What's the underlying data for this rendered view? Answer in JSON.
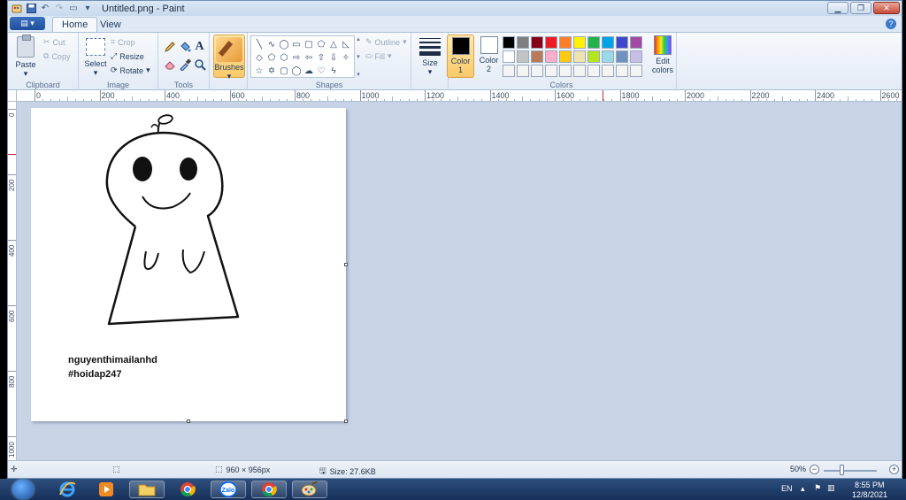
{
  "window": {
    "title": "Untitled.png - Paint"
  },
  "tabs": [
    {
      "label": "Home"
    },
    {
      "label": "View"
    }
  ],
  "ribbon": {
    "clipboard": {
      "paste": "Paste",
      "cut": "Cut",
      "copy": "Copy",
      "group_label": "Clipboard"
    },
    "image": {
      "select": "Select",
      "crop": "Crop",
      "resize": "Resize",
      "rotate": "Rotate",
      "group_label": "Image"
    },
    "tools": {
      "group_label": "Tools"
    },
    "brushes": {
      "label": "Brushes"
    },
    "shapes": {
      "outline": "Outline",
      "fill": "Fill",
      "group_label": "Shapes",
      "icons": [
        "line-icon",
        "curve-icon",
        "oval-icon",
        "rectangle-icon",
        "rounded-rectangle-icon",
        "polygon-icon",
        "triangle-icon",
        "right-triangle-icon",
        "diamond-icon",
        "pentagon-icon",
        "hexagon-icon",
        "right-arrow-icon",
        "left-arrow-icon",
        "up-arrow-icon",
        "down-arrow-icon",
        "four-point-star-icon",
        "five-point-star-icon",
        "six-point-star-icon",
        "rounded-callout-icon",
        "oval-callout-icon",
        "cloud-callout-icon",
        "heart-icon",
        "lightning-icon"
      ]
    },
    "size": {
      "label": "Size"
    },
    "colors": {
      "color1_label": "Color",
      "color1_num": "1",
      "color2_label": "Color",
      "color2_num": "2",
      "color1": "#000000",
      "color2": "#ffffff",
      "edit_label": "Edit",
      "edit_label2": "colors",
      "group_label": "Colors",
      "palette": [
        "#000000",
        "#7f7f7f",
        "#880015",
        "#ed1c24",
        "#ff7f27",
        "#fff200",
        "#22b14c",
        "#00a2e8",
        "#3f48cc",
        "#a349a4",
        "#ffffff",
        "#c3c3c3",
        "#b97a57",
        "#ffaec9",
        "#ffc90e",
        "#efe4b0",
        "#b5e61d",
        "#99d9ea",
        "#7092be",
        "#c8bfe7",
        "#f4f4f4",
        "#f4f4f4",
        "#f4f4f4",
        "#f4f4f4",
        "#f4f4f4",
        "#f4f4f4",
        "#f4f4f4",
        "#f4f4f4",
        "#f4f4f4",
        "#f4f4f4"
      ]
    }
  },
  "ruler": {
    "h_labels": [
      "0",
      "200",
      "400",
      "600",
      "800",
      "1000",
      "1200",
      "1400",
      "1600",
      "1800",
      "2000",
      "2200",
      "2400",
      "2600"
    ],
    "v_labels": [
      "0",
      "200",
      "400",
      "600",
      "800",
      "1000"
    ]
  },
  "canvas": {
    "text_line1": "nguyenthimailanhd",
    "text_line2": "#hoidap247"
  },
  "status": {
    "dimensions": "960 × 956px",
    "size": "Size: 27.6KB",
    "zoom": "50%",
    "zoom_level": 0.5
  },
  "taskbar": {
    "language": "EN",
    "time": "8:55 PM",
    "date": "12/8/2021",
    "apps": [
      "windows-start-icon",
      "internet-explorer-icon",
      "media-player-icon",
      "file-explorer-icon",
      "chrome-icon",
      "zalo-icon",
      "chrome-icon",
      "paint-icon"
    ]
  }
}
